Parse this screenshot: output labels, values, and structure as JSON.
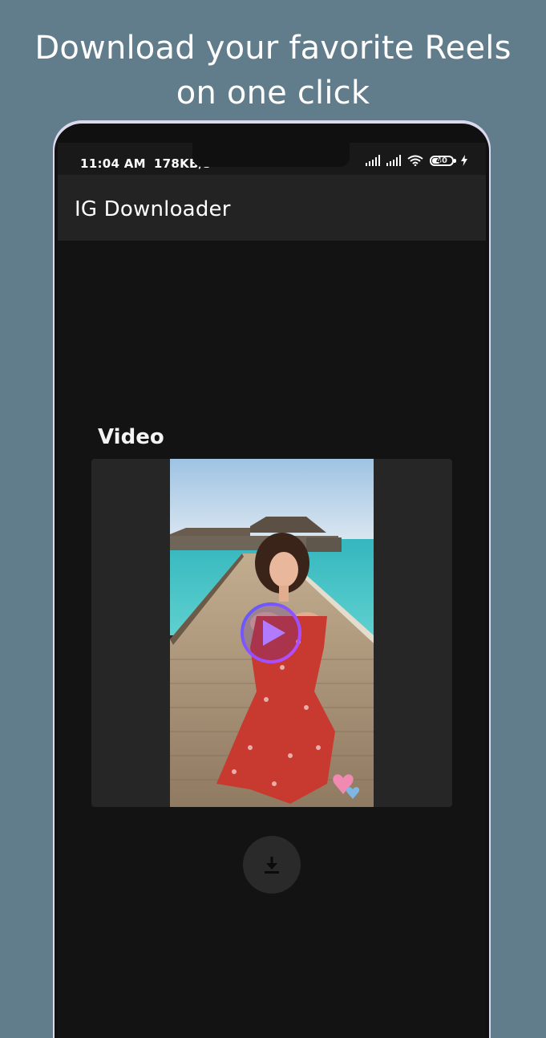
{
  "promo": {
    "line1": "Download your favorite Reels",
    "line2": "on one click"
  },
  "status_bar": {
    "time": "11:04 AM",
    "speed": "178KB/s",
    "battery": "40"
  },
  "app_bar": {
    "title": "IG Downloader"
  },
  "main": {
    "section_label": "Video"
  },
  "icons": {
    "play": "play-icon",
    "download": "download-icon",
    "signal": "signal-icon",
    "wifi": "wifi-icon",
    "battery": "battery-icon",
    "charging": "charging-icon"
  },
  "colors": {
    "background": "#617d8b",
    "app_bar": "#232323",
    "content": "#131313",
    "card": "#262626",
    "play_ring": "#8a4bff"
  }
}
